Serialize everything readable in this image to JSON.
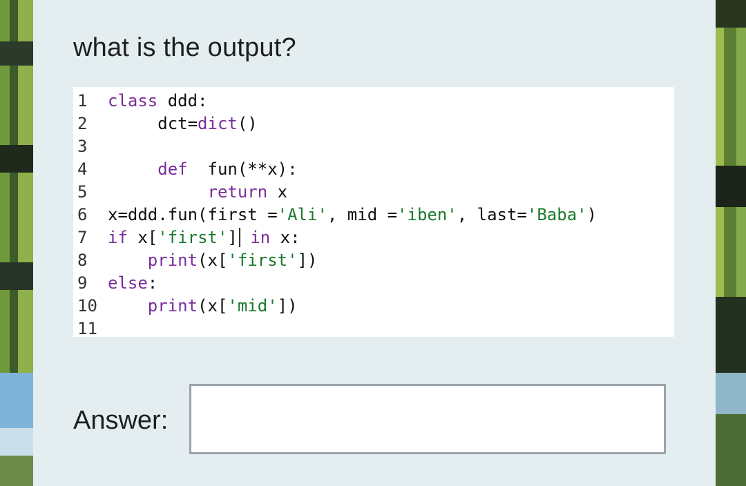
{
  "question": "what is the output?",
  "code_lines": [
    {
      "num": "1",
      "parts": [
        {
          "t": "class ",
          "c": "kw"
        },
        {
          "t": "ddd:",
          "c": ""
        }
      ]
    },
    {
      "num": "2",
      "parts": [
        {
          "t": "     dct=",
          "c": ""
        },
        {
          "t": "dict",
          "c": "kw"
        },
        {
          "t": "()",
          "c": ""
        }
      ]
    },
    {
      "num": "3",
      "parts": []
    },
    {
      "num": "4",
      "parts": [
        {
          "t": "     ",
          "c": ""
        },
        {
          "t": "def",
          "c": "kw"
        },
        {
          "t": "  fun(**x):",
          "c": ""
        }
      ]
    },
    {
      "num": "5",
      "parts": [
        {
          "t": "          ",
          "c": ""
        },
        {
          "t": "return",
          "c": "kw"
        },
        {
          "t": " x",
          "c": ""
        }
      ]
    },
    {
      "num": "6",
      "parts": [
        {
          "t": "x=ddd.fun(first =",
          "c": ""
        },
        {
          "t": "'Ali'",
          "c": "str"
        },
        {
          "t": ", mid =",
          "c": ""
        },
        {
          "t": "'iben'",
          "c": "str"
        },
        {
          "t": ", last=",
          "c": ""
        },
        {
          "t": "'Baba'",
          "c": "str"
        },
        {
          "t": ")",
          "c": ""
        }
      ]
    },
    {
      "num": "7",
      "parts": [
        {
          "t": "if",
          "c": "kw"
        },
        {
          "t": " x[",
          "c": ""
        },
        {
          "t": "'first'",
          "c": "str"
        },
        {
          "t": "]",
          "c": ""
        },
        {
          "t": "",
          "c": "caret"
        },
        {
          "t": " ",
          "c": ""
        },
        {
          "t": "in",
          "c": "kw"
        },
        {
          "t": " x:",
          "c": ""
        }
      ]
    },
    {
      "num": "8",
      "parts": [
        {
          "t": "    ",
          "c": ""
        },
        {
          "t": "print",
          "c": "kw"
        },
        {
          "t": "(x[",
          "c": ""
        },
        {
          "t": "'first'",
          "c": "str"
        },
        {
          "t": "])",
          "c": ""
        }
      ]
    },
    {
      "num": "9",
      "parts": [
        {
          "t": "else",
          "c": "kw"
        },
        {
          "t": ":",
          "c": ""
        }
      ]
    },
    {
      "num": "10",
      "parts": [
        {
          "t": "    ",
          "c": ""
        },
        {
          "t": "print",
          "c": "kw"
        },
        {
          "t": "(x[",
          "c": ""
        },
        {
          "t": "'mid'",
          "c": "str"
        },
        {
          "t": "])",
          "c": ""
        }
      ]
    },
    {
      "num": "11",
      "parts": []
    }
  ],
  "answer": {
    "label": "Answer:",
    "value": ""
  },
  "colors": {
    "keyword": "#7a2e9a",
    "string": "#1a7a2c",
    "panel": "#e4eef0"
  }
}
